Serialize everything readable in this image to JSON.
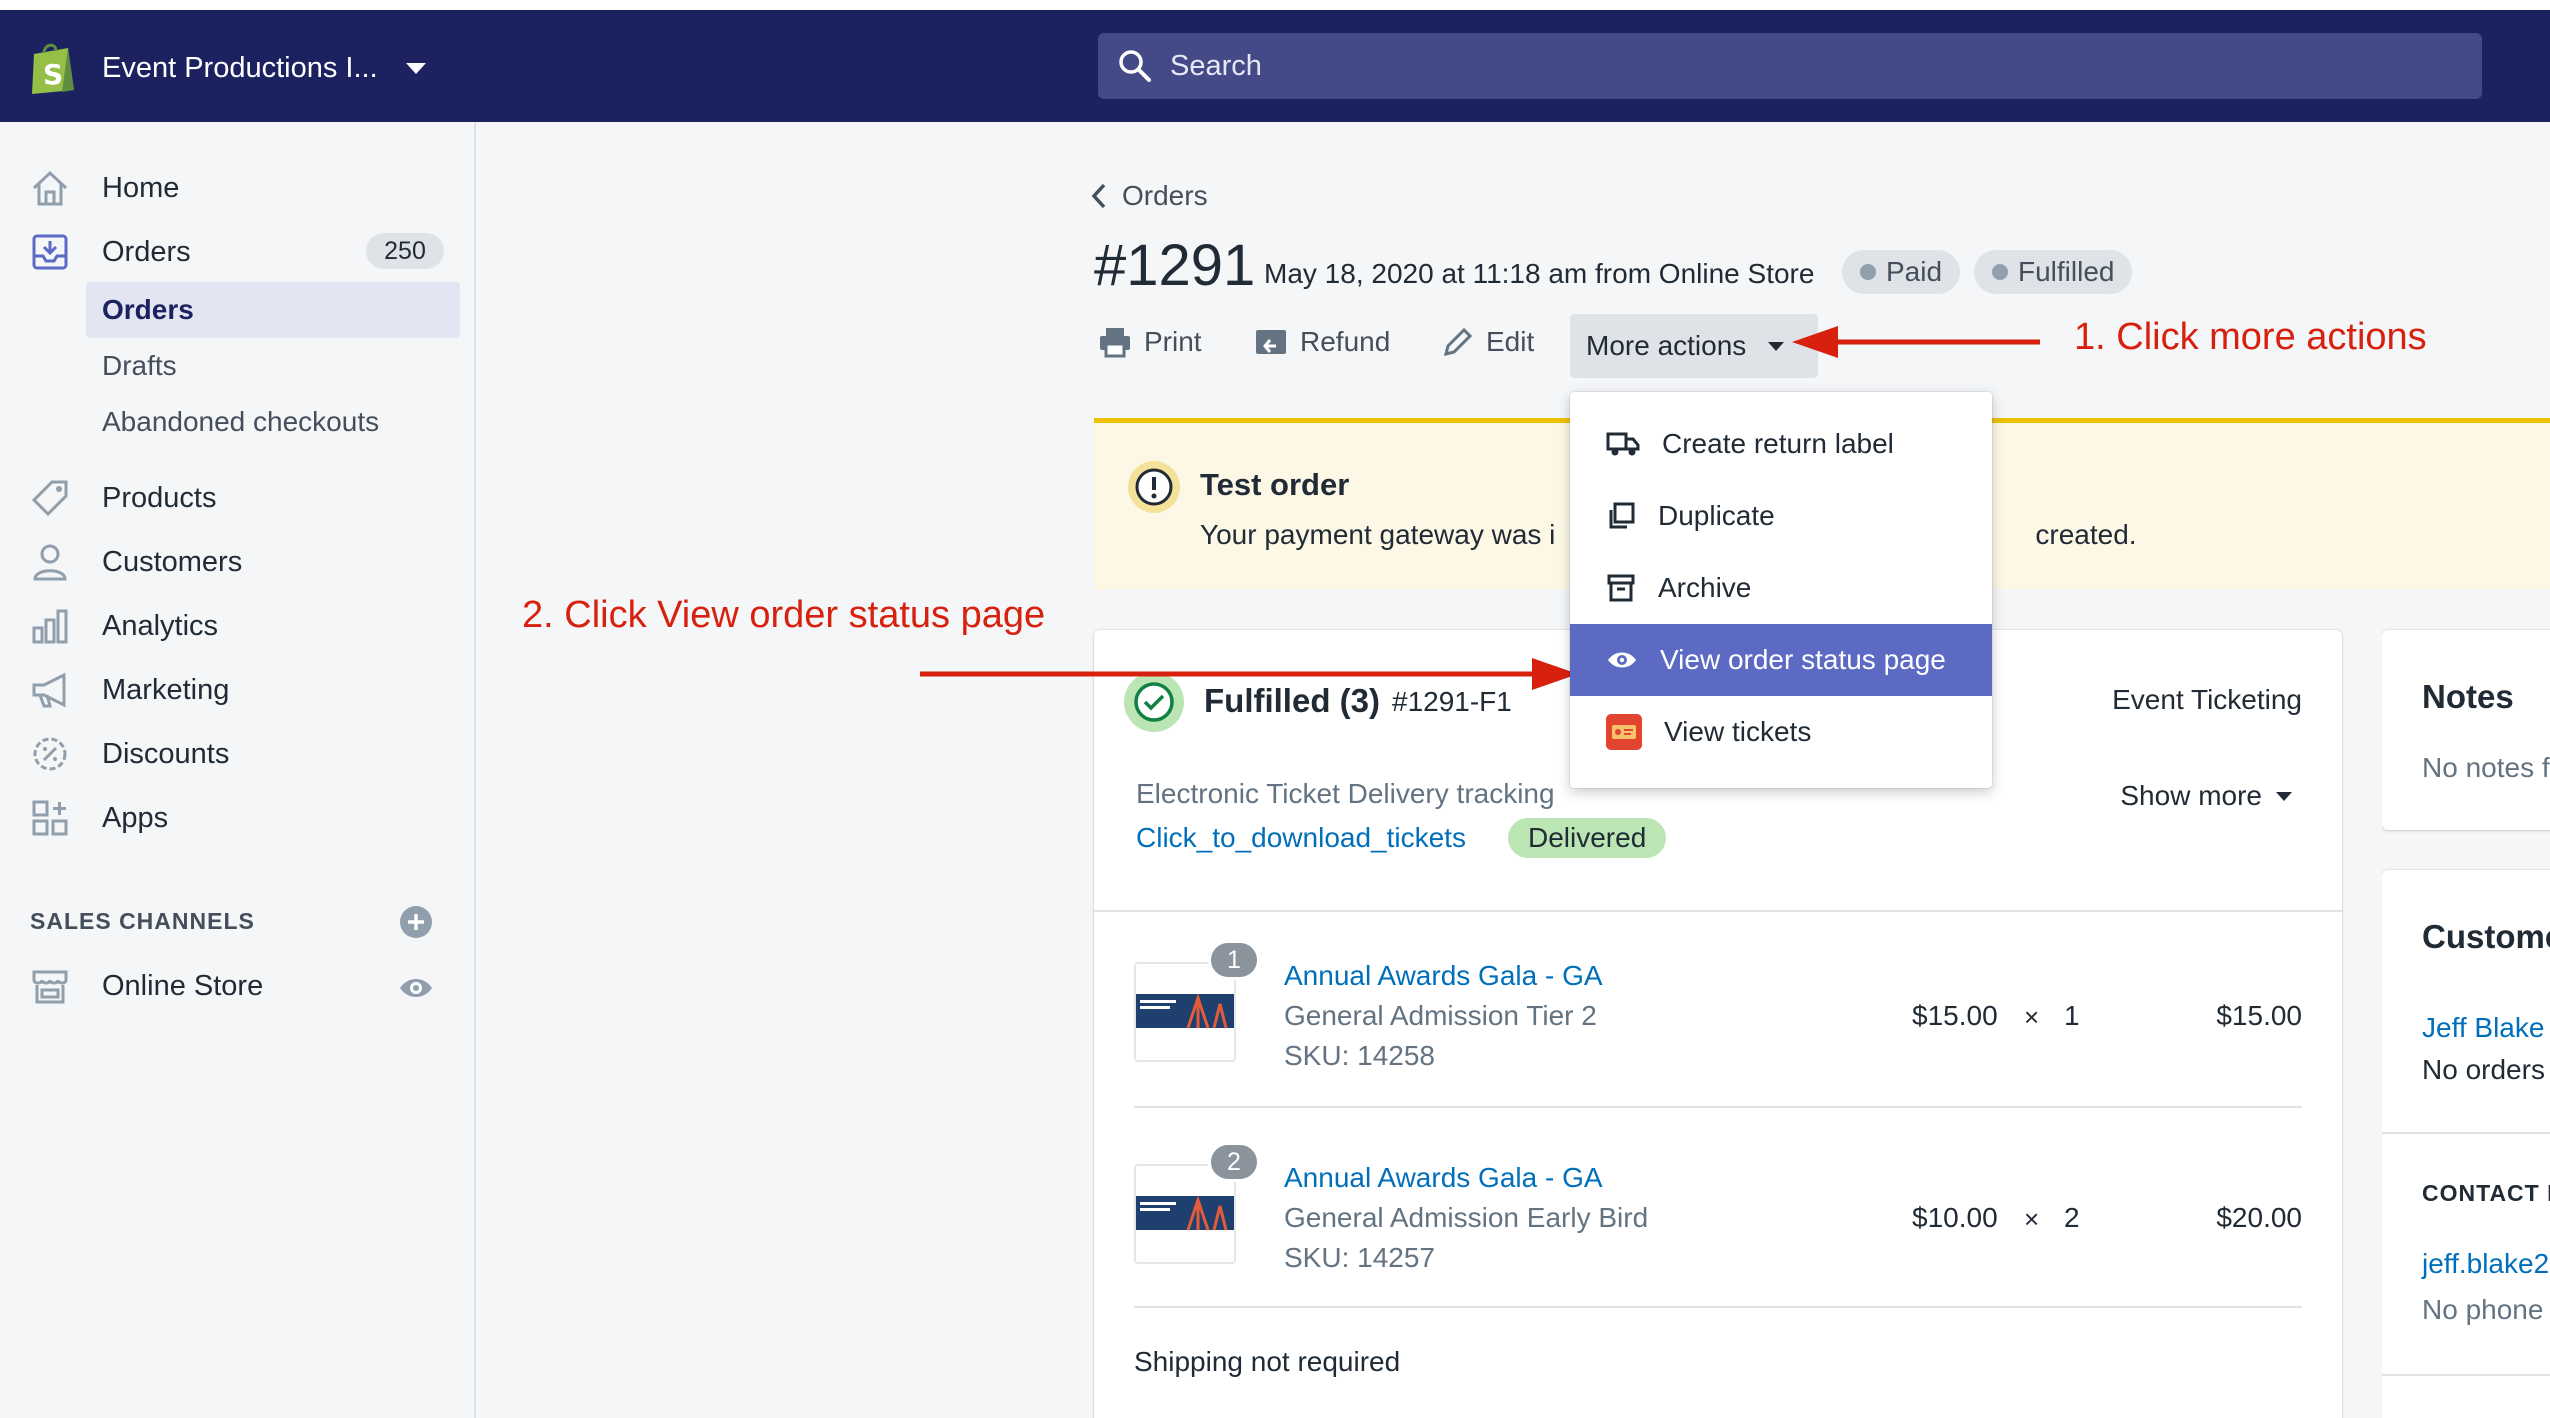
{
  "topbar": {
    "store_name": "Event Productions I...",
    "search_placeholder": "Search"
  },
  "sidebar": {
    "items": [
      {
        "label": "Home",
        "icon": "home-icon"
      },
      {
        "label": "Orders",
        "icon": "orders-icon",
        "badge": "250"
      },
      {
        "label": "Products",
        "icon": "tag-icon"
      },
      {
        "label": "Customers",
        "icon": "person-icon"
      },
      {
        "label": "Analytics",
        "icon": "bar-chart-icon"
      },
      {
        "label": "Marketing",
        "icon": "megaphone-icon"
      },
      {
        "label": "Discounts",
        "icon": "discount-icon"
      },
      {
        "label": "Apps",
        "icon": "apps-grid-icon"
      }
    ],
    "orders_sub": [
      "Orders",
      "Drafts",
      "Abandoned checkouts"
    ],
    "sales_channels_title": "SALES CHANNELS",
    "online_store": "Online Store"
  },
  "order": {
    "breadcrumb": "Orders",
    "number": "#1291",
    "meta": "May 18, 2020 at 11:18 am from Online Store",
    "status_paid": "Paid",
    "status_fulfilled": "Fulfilled"
  },
  "actions": {
    "print": "Print",
    "refund": "Refund",
    "edit": "Edit",
    "more": "More actions"
  },
  "dropdown": {
    "items": [
      {
        "label": "Create return label",
        "icon": "truck-icon"
      },
      {
        "label": "Duplicate",
        "icon": "duplicate-icon"
      },
      {
        "label": "Archive",
        "icon": "archive-icon"
      },
      {
        "label": "View order status page",
        "icon": "eye-icon"
      },
      {
        "label": "View tickets",
        "icon": "tickets-app-icon"
      }
    ]
  },
  "annotations": {
    "step1": "1. Click more actions",
    "step2": "2. Click View order status page"
  },
  "banner": {
    "title": "Test order",
    "message_start": "Your payment gateway was i",
    "message_end": "created."
  },
  "fulfillment": {
    "title": "Fulfilled (3)",
    "code": "#1291-F1",
    "location": "Event Ticketing",
    "tracking_label": "Electronic Ticket Delivery tracking",
    "tracking_link": "Click_to_download_tickets",
    "delivered": "Delivered",
    "show_more": "Show more",
    "line_items": [
      {
        "qty_badge": "1",
        "title": "Annual Awards Gala - GA",
        "variant": "General Admission Tier 2",
        "sku": "SKU: 14258",
        "price": "$15.00",
        "x": "×",
        "qty": "1",
        "total": "$15.00"
      },
      {
        "qty_badge": "2",
        "title": "Annual Awards Gala - GA",
        "variant": "General Admission Early Bird",
        "sku": "SKU: 14257",
        "price": "$10.00",
        "x": "×",
        "qty": "2",
        "total": "$20.00"
      }
    ],
    "shipping": "Shipping not required"
  },
  "notes": {
    "title": "Notes",
    "text": "No notes f"
  },
  "customer": {
    "title": "Custome",
    "name": "Jeff Blake",
    "orders": "No orders",
    "contact_title": "CONTACT I",
    "email": "jeff.blake2",
    "phone": "No phone"
  },
  "colors": {
    "topbar": "#1c2260",
    "accent": "#5c6ac4",
    "annotation": "#d8200f",
    "link": "#006fbb"
  }
}
